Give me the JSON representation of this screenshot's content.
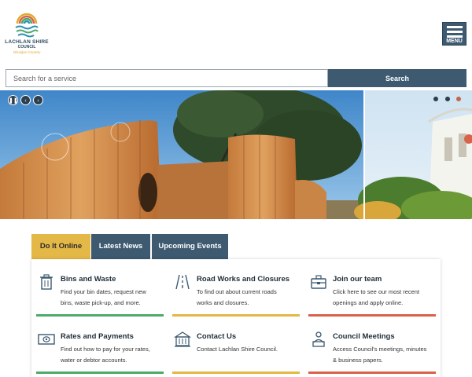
{
  "header": {
    "logo": {
      "name": "LACHLAN SHIRE",
      "subname": "COUNCIL",
      "tagline": "Wiradjuri Country"
    },
    "menu": {
      "label": "MENU",
      "icon": "hamburger-icon"
    }
  },
  "search": {
    "placeholder": "Search for a service",
    "value": "",
    "button_label": "Search"
  },
  "hero": {
    "controls": {
      "pause_icon": "pause-icon",
      "prev_icon": "chevron-left-icon",
      "next_icon": "chevron-right-icon"
    },
    "slide_count": 3,
    "active_slide": 3
  },
  "tabs": [
    {
      "label": "Do It Online",
      "active": true
    },
    {
      "label": "Latest News",
      "active": false
    },
    {
      "label": "Upcoming Events",
      "active": false
    }
  ],
  "services": [
    {
      "title": "Bins and Waste",
      "desc": "Find your bin dates, request new bins, waste pick-up, and more.",
      "icon": "bin-icon",
      "color": "#4daa6b"
    },
    {
      "title": "Road Works and Closures",
      "desc": "To find out about current roads works and closures.",
      "icon": "road-icon",
      "color": "#e4b847"
    },
    {
      "title": "Join our team",
      "desc": "Click here to see our most recent openings and apply online.",
      "icon": "briefcase-icon",
      "color": "#d9634a"
    },
    {
      "title": "Rates and Payments",
      "desc": "Find out how to pay for your rates, water or debtor accounts.",
      "icon": "money-icon",
      "color": "#4daa6b"
    },
    {
      "title": "Contact Us",
      "desc": "Contact Lachlan Shire Council.",
      "icon": "building-icon",
      "color": "#e4b847"
    },
    {
      "title": "Council Meetings",
      "desc": "Access Council's meetings, minutes & business papers.",
      "icon": "meeting-icon",
      "color": "#d9634a"
    }
  ],
  "colors": {
    "primary": "#3d5a70",
    "accent_yellow": "#e4b847",
    "accent_green": "#4daa6b",
    "accent_red": "#d9634a"
  }
}
